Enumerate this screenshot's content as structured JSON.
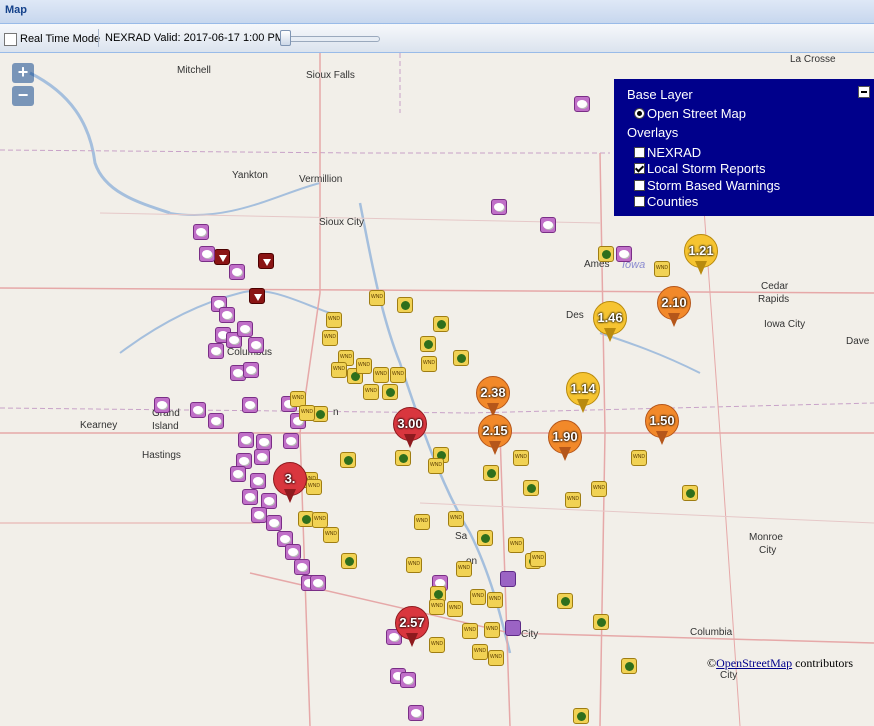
{
  "panel": {
    "title": "Map"
  },
  "toolbar": {
    "realtime_label": "Real Time Mode",
    "realtime_checked": false,
    "nexrad_label": "NEXRAD Valid: 2017-06-17 1:00 PM"
  },
  "zoom": {
    "in_label": "+",
    "out_label": "−"
  },
  "layer_switcher": {
    "base_header": "Base Layer",
    "base_layers": [
      {
        "label": "Open Street Map",
        "selected": true
      }
    ],
    "overlay_header": "Overlays",
    "overlays": [
      {
        "label": "NEXRAD",
        "checked": false
      },
      {
        "label": "Local Storm Reports",
        "checked": true
      },
      {
        "label": "Storm Based Warnings",
        "checked": false
      },
      {
        "label": "Counties",
        "checked": false
      }
    ]
  },
  "places": {
    "mitchell": "Mitchell",
    "sioux_falls": "Sioux Falls",
    "la_crosse": "La Crosse",
    "yankton": "Yankton",
    "vermillion": "Vermillion",
    "sioux_city": "Sioux City",
    "ames": "Ames",
    "iowa": "Iowa",
    "cedar_rapids_1": "Cedar",
    "cedar_rapids_2": "Rapids",
    "iowa_city": "Iowa City",
    "des_moines": "Des",
    "davenport": "Dave",
    "columbus": "Columbus",
    "kearney": "Kearney",
    "grand_1": "Grand",
    "grand_2": "Island",
    "hastings": "Hastings",
    "lincoln_fragment": "n",
    "omaha_fragment": "a",
    "monroe_1": "Monroe",
    "monroe_2": "City",
    "columbia": "Columbia",
    "kc_fragment": "City",
    "jc_fragment": "City",
    "st_joseph_fragment": "Sa",
    "atchison_fragment": "on"
  },
  "rainfall_labels": [
    "1.21",
    "2.10",
    "1.46",
    "2.38",
    "1.14",
    "3.00",
    "2.15",
    "1.90",
    "1.50",
    "3.",
    "2.57"
  ],
  "colors": {
    "rain_high": "#d9363e",
    "rain_mid": "#f2892a",
    "rain_low": "#f6c431",
    "layer_bg": "#00008b",
    "hail": "#c070c8",
    "wind": "#f1d254",
    "tornado": "#8a1414"
  },
  "attribution": {
    "prefix": "©",
    "link": "OpenStreetMap",
    "suffix": " contributors"
  }
}
